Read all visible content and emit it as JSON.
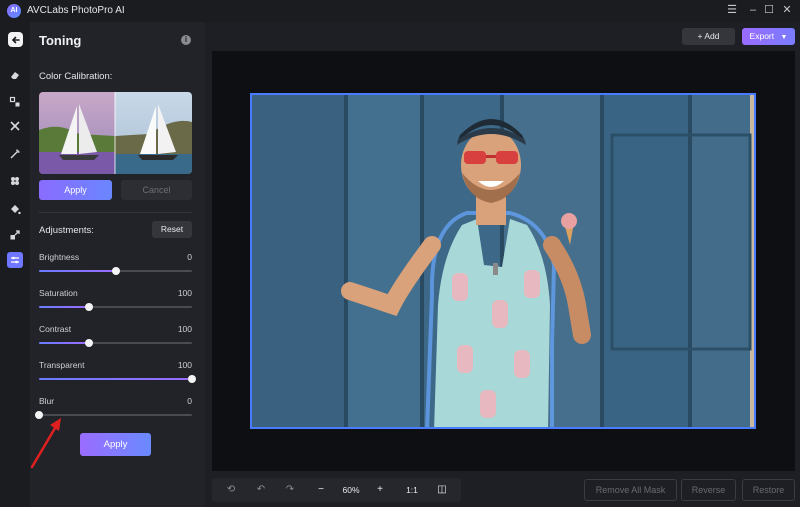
{
  "app": {
    "title": "AVCLabs PhotoPro AI",
    "logo_text": "AI"
  },
  "window_controls": [
    "menu-icon",
    "minimize-icon",
    "maximize-icon",
    "close-icon"
  ],
  "rail": {
    "items": [
      "back-icon",
      "eraser-icon",
      "replace-icon",
      "crop-icon",
      "magic-icon",
      "sparkle-icon",
      "fill-icon",
      "expand-icon",
      "toning-icon"
    ],
    "active": "toning-icon"
  },
  "panel": {
    "title": "Toning",
    "color_calibration_label": "Color Calibration:",
    "apply_label": "Apply",
    "cancel_label": "Cancel",
    "adjustments_label": "Adjustments:",
    "reset_label": "Reset",
    "sliders": [
      {
        "label": "Brightness",
        "value": "0",
        "fraction": 0.5
      },
      {
        "label": "Saturation",
        "value": "100",
        "fraction": 0.33
      },
      {
        "label": "Contrast",
        "value": "100",
        "fraction": 0.33
      },
      {
        "label": "Transparent",
        "value": "100",
        "fraction": 1.0
      },
      {
        "label": "Blur",
        "value": "0",
        "fraction": 0.0
      }
    ],
    "apply_bottom_label": "Apply"
  },
  "header": {
    "add_label": "+ Add",
    "export_label": "Export"
  },
  "toolbar": {
    "zoom": "60%",
    "ratio": "1:1"
  },
  "footer": {
    "remove_all_mask_label": "Remove All Mask",
    "reverse_label": "Reverse",
    "restore_label": "Restore"
  },
  "colors": {
    "accent": "#7a6cff",
    "selection_outline": "#4a7cff",
    "arrow": "#e02020"
  }
}
